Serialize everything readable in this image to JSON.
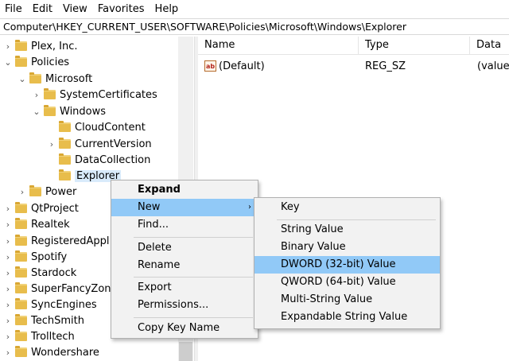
{
  "menubar": [
    "File",
    "Edit",
    "View",
    "Favorites",
    "Help"
  ],
  "address": "Computer\\HKEY_CURRENT_USER\\SOFTWARE\\Policies\\Microsoft\\Windows\\Explorer",
  "tree": {
    "items": [
      {
        "label": "Plex, Inc.",
        "expander": "›"
      },
      {
        "label": "Policies",
        "expander": "⌄"
      },
      {
        "label": "Microsoft",
        "expander": "⌄"
      },
      {
        "label": "SystemCertificates",
        "expander": "›"
      },
      {
        "label": "Windows",
        "expander": "⌄"
      },
      {
        "label": "CloudContent",
        "expander": ""
      },
      {
        "label": "CurrentVersion",
        "expander": "›"
      },
      {
        "label": "DataCollection",
        "expander": ""
      },
      {
        "label": "Explorer",
        "expander": ""
      },
      {
        "label": "Power",
        "expander": "›"
      },
      {
        "label": "QtProject",
        "expander": "›"
      },
      {
        "label": "Realtek",
        "expander": "›"
      },
      {
        "label": "RegisteredAppl",
        "expander": "›"
      },
      {
        "label": "Spotify",
        "expander": "›"
      },
      {
        "label": "Stardock",
        "expander": "›"
      },
      {
        "label": "SuperFancyZone",
        "expander": "›"
      },
      {
        "label": "SyncEngines",
        "expander": "›"
      },
      {
        "label": "TechSmith",
        "expander": "›"
      },
      {
        "label": "Trolltech",
        "expander": "›"
      },
      {
        "label": "Wondershare",
        "expander": "›"
      }
    ]
  },
  "columns": {
    "name": "Name",
    "type": "Type",
    "data": "Data"
  },
  "values": [
    {
      "icon": "ab",
      "name": "(Default)",
      "type": "REG_SZ",
      "data": "(value"
    }
  ],
  "context_menu": {
    "expand": "Expand",
    "new": "New",
    "find": "Find...",
    "delete": "Delete",
    "rename": "Rename",
    "export": "Export",
    "permissions": "Permissions...",
    "copy_key_name": "Copy Key Name",
    "arrow": "›"
  },
  "submenu": {
    "key": "Key",
    "string": "String Value",
    "binary": "Binary Value",
    "dword": "DWORD (32-bit) Value",
    "qword": "QWORD (64-bit) Value",
    "multi": "Multi-String Value",
    "expandable": "Expandable String Value"
  },
  "colors": {
    "highlight": "#91c9f7",
    "selection": "#d9ebfb",
    "folder": "#e8bd4c"
  }
}
